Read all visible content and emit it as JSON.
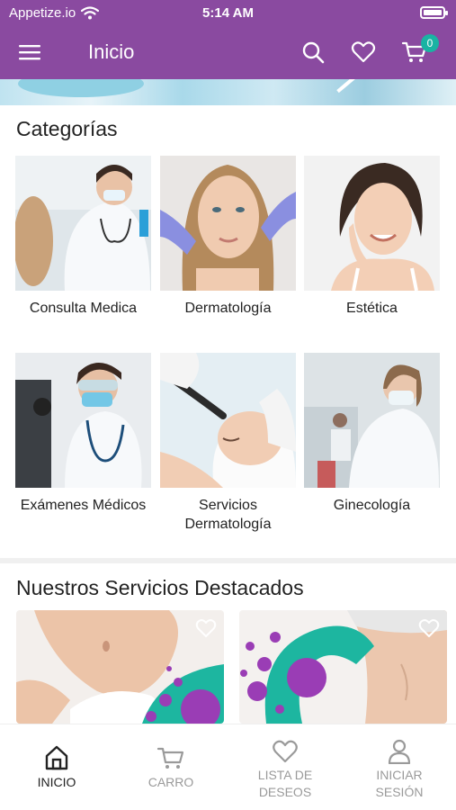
{
  "status_bar": {
    "carrier": "Appetize.io",
    "time": "5:14 AM",
    "icons": [
      "wifi-icon",
      "battery-icon"
    ]
  },
  "header": {
    "title": "Inicio",
    "cart_count": "0",
    "icons": [
      "menu-icon",
      "search-icon",
      "heart-icon",
      "cart-icon"
    ],
    "background_color": "#8a4aa0",
    "badge_color": "#19b3a3"
  },
  "categories": {
    "title": "Categorías",
    "items": [
      {
        "label": "Consulta Medica",
        "image": "doctor-with-stethoscope"
      },
      {
        "label": "Dermatología",
        "image": "woman-face-gloved-hands"
      },
      {
        "label": "Estética",
        "image": "smiling-woman-touching-face"
      },
      {
        "label": "Exámenes Médicos",
        "image": "lab-technician-microscope"
      },
      {
        "label": "Servicios Dermatología",
        "image": "facial-treatment-device"
      },
      {
        "label": "Ginecología",
        "image": "female-doctor-masked"
      }
    ]
  },
  "featured": {
    "title": "Nuestros Servicios Destacados",
    "items": [
      {
        "image": "body-treatment-towel",
        "icon": "heart-outline-icon"
      },
      {
        "image": "abdomen-treatment",
        "icon": "heart-outline-icon"
      }
    ]
  },
  "tabbar": {
    "tabs": [
      {
        "label": "INICIO",
        "icon": "home-icon",
        "active": true
      },
      {
        "label": "CARRO",
        "icon": "cart-icon",
        "active": false
      },
      {
        "label": "LISTA DE DESEOS",
        "label_lines": [
          "LISTA DE",
          "DESEOS"
        ],
        "icon": "heart-icon",
        "active": false
      },
      {
        "label": "INICIAR SESIÓN",
        "label_lines": [
          "INICIAR",
          "SESIÓN"
        ],
        "icon": "user-icon",
        "active": false
      }
    ]
  }
}
